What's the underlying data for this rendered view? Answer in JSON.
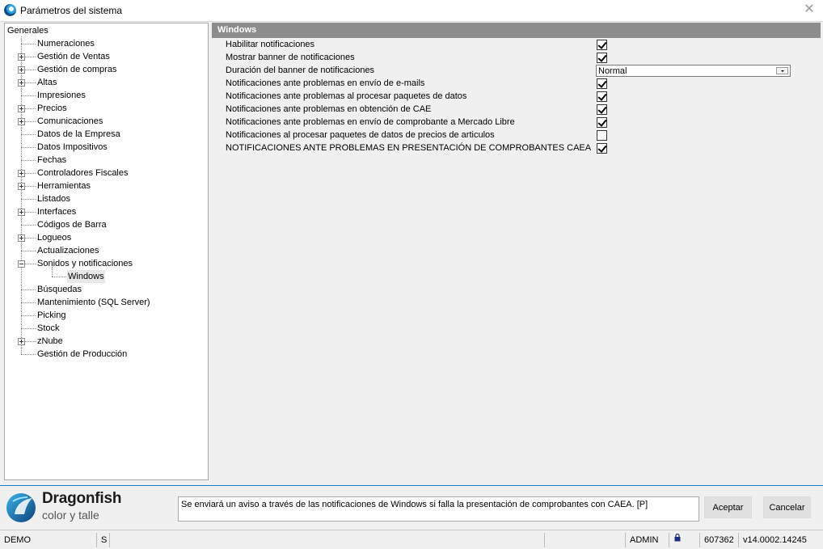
{
  "window": {
    "title": "Parámetros del sistema",
    "close_symbol": "✕"
  },
  "tree": {
    "root": "Generales",
    "items": [
      {
        "label": "Numeraciones",
        "expander": "none"
      },
      {
        "label": "Gestión de Ventas",
        "expander": "plus"
      },
      {
        "label": "Gestión de compras",
        "expander": "plus"
      },
      {
        "label": "Altas",
        "expander": "plus"
      },
      {
        "label": "Impresiones",
        "expander": "none"
      },
      {
        "label": "Precios",
        "expander": "plus"
      },
      {
        "label": "Comunicaciones",
        "expander": "plus"
      },
      {
        "label": "Datos de la Empresa",
        "expander": "none"
      },
      {
        "label": "Datos Impositivos",
        "expander": "none"
      },
      {
        "label": "Fechas",
        "expander": "none"
      },
      {
        "label": "Controladores Fiscales",
        "expander": "plus"
      },
      {
        "label": "Herramientas",
        "expander": "plus"
      },
      {
        "label": "Listados",
        "expander": "none"
      },
      {
        "label": "Interfaces",
        "expander": "plus"
      },
      {
        "label": "Códigos de Barra",
        "expander": "none"
      },
      {
        "label": "Logueos",
        "expander": "plus"
      },
      {
        "label": "Actualizaciones",
        "expander": "none"
      },
      {
        "label": "Sonidos y notificaciones",
        "expander": "minus"
      },
      {
        "label": "Windows",
        "expander": "child",
        "selected": true
      },
      {
        "label": "Búsquedas",
        "expander": "none"
      },
      {
        "label": "Mantenimiento (SQL Server)",
        "expander": "none"
      },
      {
        "label": "Picking",
        "expander": "none"
      },
      {
        "label": "Stock",
        "expander": "none"
      },
      {
        "label": "zNube",
        "expander": "plus"
      },
      {
        "label": "Gestión de Producción",
        "expander": "none"
      }
    ]
  },
  "panel": {
    "header": "Windows",
    "options": [
      {
        "label": "Habilitar notificaciones",
        "type": "checkbox",
        "checked": true
      },
      {
        "label": "Mostrar banner de notificaciones",
        "type": "checkbox",
        "checked": true
      },
      {
        "label": "Duración del banner de notificaciones",
        "type": "select",
        "value": "Normal"
      },
      {
        "label": "Notificaciones ante problemas en envío de e-mails",
        "type": "checkbox",
        "checked": true
      },
      {
        "label": "Notificaciones ante problemas al procesar paquetes de datos",
        "type": "checkbox",
        "checked": true
      },
      {
        "label": "Notificaciones ante problemas en obtención de CAE",
        "type": "checkbox",
        "checked": true
      },
      {
        "label": "Notificaciones ante problemas en envío de comprobante a Mercado Libre",
        "type": "checkbox",
        "checked": true
      },
      {
        "label": "Notificaciones al procesar paquetes de datos de precios de articulos",
        "type": "checkbox",
        "checked": false
      },
      {
        "label": "NOTIFICACIONES ANTE PROBLEMAS EN PRESENTACIÓN DE COMPROBANTES CAEA",
        "type": "checkbox",
        "checked": true
      }
    ]
  },
  "branding": {
    "title": "Dragonfish",
    "subtitle": "color y talle"
  },
  "help_text": "Se enviará un aviso a través de las notificaciones de Windows si falla la presentación de comprobantes con CAEA. [P]",
  "buttons": {
    "accept": "Aceptar",
    "cancel": "Cancelar"
  },
  "statusbar": {
    "db": "DEMO",
    "mode": "S",
    "user": "ADMIN",
    "code": "607362",
    "version": "v14.0002.14245"
  },
  "colors": {
    "header_bg": "#8c8c8c",
    "accent": "#1a80c8"
  }
}
